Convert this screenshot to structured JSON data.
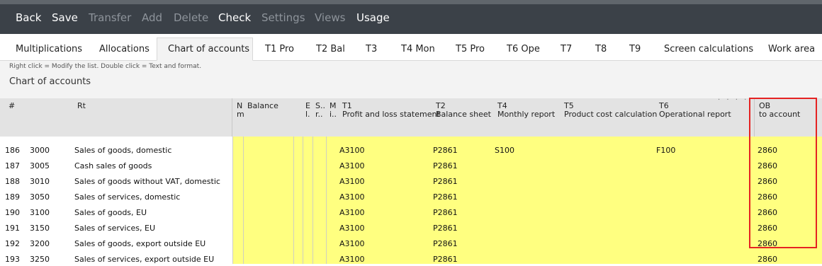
{
  "toolbar": {
    "back": "Back",
    "save": "Save",
    "transfer": "Transfer",
    "add": "Add",
    "delete": "Delete",
    "check": "Check",
    "settings": "Settings",
    "views": "Views",
    "usage": "Usage"
  },
  "tabs": [
    "Multiplications",
    "Allocations",
    "Chart of accounts",
    "T1 Pro",
    "T2 Bal",
    "T3",
    "T4 Mon",
    "T5 Pro",
    "T6 Ope",
    "T7",
    "T8",
    "T9",
    "Screen calculations",
    "Work area"
  ],
  "active_tab": "Chart of accounts",
  "hint": "Right click = Modify the list. Double click = Text and format.",
  "page_title": "Chart of accounts",
  "header": {
    "num": "#",
    "rt": "Rt",
    "n1": "N",
    "n2": "m",
    "balance": "Balance",
    "e1": "E",
    "e2": "l.",
    "s1": "S..",
    "s2": "r..",
    "m1": "M",
    "m2": "i..",
    "t1a": "T1",
    "t1b": "Profit and loss statement",
    "t2a": "T2",
    "t2b": "Balance sheet",
    "t4a": "T4",
    "t4b": "Monthly report",
    "t5a": "T5",
    "t5b": "Product cost calculation",
    "t6a": "T6",
    "t6b": "Operational report",
    "oba": "OB",
    "obb": "to account"
  },
  "rows": [
    {
      "idx": "186",
      "acct": "3000",
      "name": "Sales of goods, domestic",
      "t1": "A3100",
      "t2": "P2861",
      "t4": "S100",
      "t6": "F100",
      "ob": "2860"
    },
    {
      "idx": "187",
      "acct": "3005",
      "name": "Cash sales of goods",
      "t1": "A3100",
      "t2": "P2861",
      "t4": "",
      "t6": "",
      "ob": "2860"
    },
    {
      "idx": "188",
      "acct": "3010",
      "name": "Sales of goods without VAT, domestic",
      "t1": "A3100",
      "t2": "P2861",
      "t4": "",
      "t6": "",
      "ob": "2860"
    },
    {
      "idx": "189",
      "acct": "3050",
      "name": "Sales of services, domestic",
      "t1": "A3100",
      "t2": "P2861",
      "t4": "",
      "t6": "",
      "ob": "2860"
    },
    {
      "idx": "190",
      "acct": "3100",
      "name": "Sales of goods, EU",
      "t1": "A3100",
      "t2": "P2861",
      "t4": "",
      "t6": "",
      "ob": "2860"
    },
    {
      "idx": "191",
      "acct": "3150",
      "name": "Sales of services, EU",
      "t1": "A3100",
      "t2": "P2861",
      "t4": "",
      "t6": "",
      "ob": "2860"
    },
    {
      "idx": "192",
      "acct": "3200",
      "name": "Sales of goods, export outside EU",
      "t1": "A3100",
      "t2": "P2861",
      "t4": "",
      "t6": "",
      "ob": "2860"
    },
    {
      "idx": "193",
      "acct": "3250",
      "name": "Sales of services, export outside EU",
      "t1": "A3100",
      "t2": "P2861",
      "t4": "",
      "t6": "",
      "ob": "2860"
    }
  ],
  "colors": {
    "toolbar_bg": "#3b4148",
    "row_highlight": "#ffff80",
    "callout": "#e52222"
  }
}
